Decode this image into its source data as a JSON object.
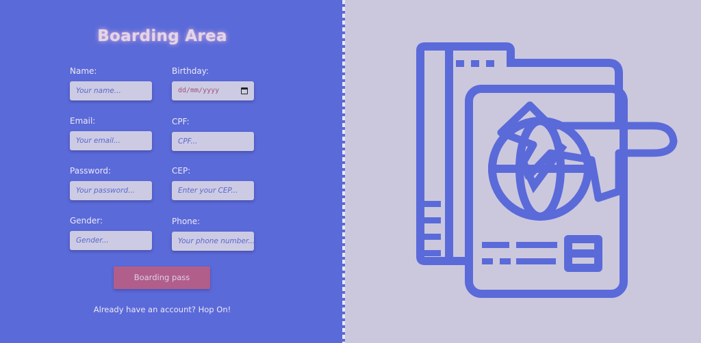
{
  "form": {
    "title": "Boarding Area",
    "fields": {
      "name": {
        "label": "Name:",
        "placeholder": "Your name..."
      },
      "birthday": {
        "label": "Birthday:",
        "placeholder": "dd/mm/yyyy"
      },
      "email": {
        "label": "Email:",
        "placeholder": "Your email..."
      },
      "cpf": {
        "label": "CPF:",
        "placeholder": "CPF..."
      },
      "password": {
        "label": "Password:",
        "placeholder": "Your password..."
      },
      "cep": {
        "label": "CEP:",
        "placeholder": "Enter your CEP..."
      },
      "gender": {
        "label": "Gender:",
        "placeholder": "Gender..."
      },
      "phone": {
        "label": "Phone:",
        "placeholder": "Your phone number..."
      }
    },
    "submit_label": "Boarding pass",
    "login_prompt": "Already have an account? Hop On!"
  },
  "illustration": {
    "icon": "passport-travel-icon",
    "color": "#5b6ad9"
  },
  "colors": {
    "left_bg": "#5b6ad9",
    "right_bg": "#cbc8de",
    "button_bg": "#b15e8a",
    "input_bg": "#cccbe3"
  }
}
